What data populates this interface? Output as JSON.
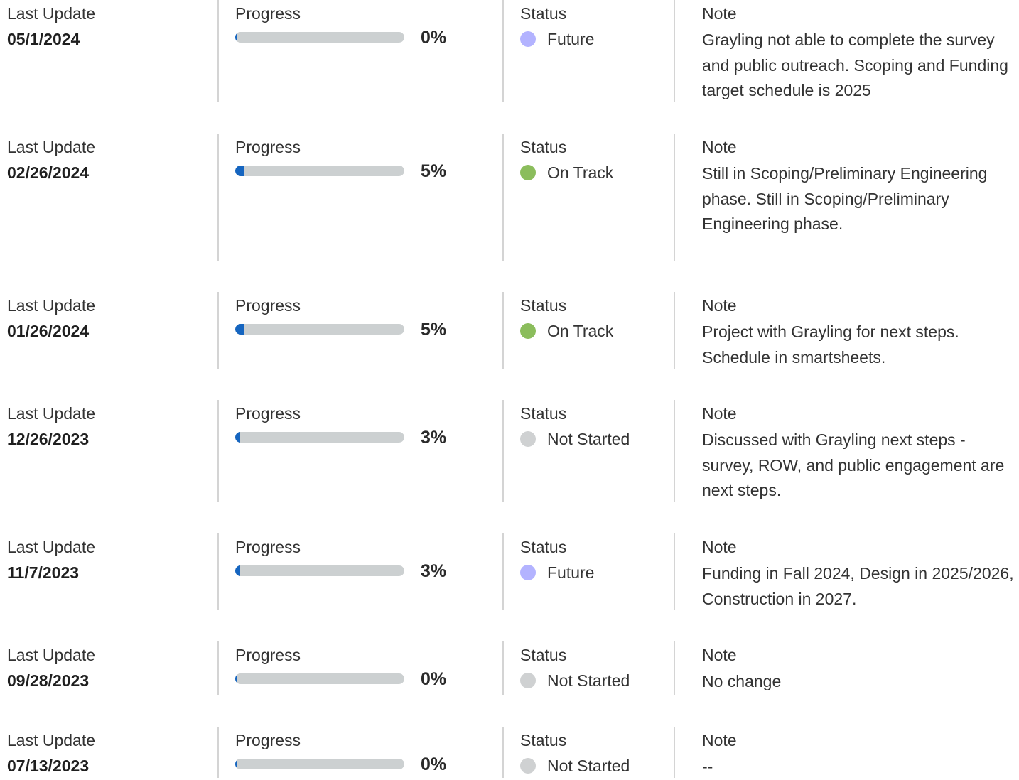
{
  "labels": {
    "last_update": "Last Update",
    "progress": "Progress",
    "status": "Status",
    "note": "Note"
  },
  "colors": {
    "progress_fill": "#1565c0",
    "progress_track": "#ccd0d1",
    "status_future": "#b3b3ff",
    "status_on_track": "#8bbd5c",
    "status_not_started": "#cfd1d2"
  },
  "updates": [
    {
      "date": "05/1/2024",
      "progress_pct": 0,
      "progress_label": "0%",
      "status": "Future",
      "status_color": "#b3b3ff",
      "note": "Grayling not able to complete the survey and public outreach. Scoping and Funding target schedule is 2025"
    },
    {
      "date": "02/26/2024",
      "progress_pct": 5,
      "progress_label": "5%",
      "status": "On Track",
      "status_color": "#8bbd5c",
      "note": "Still in Scoping/Preliminary Engineering phase. Still in Scoping/Preliminary Engineering phase."
    },
    {
      "date": "01/26/2024",
      "progress_pct": 5,
      "progress_label": "5%",
      "status": "On Track",
      "status_color": "#8bbd5c",
      "note": "Project with Grayling for next steps. Schedule in smartsheets."
    },
    {
      "date": "12/26/2023",
      "progress_pct": 3,
      "progress_label": "3%",
      "status": "Not Started",
      "status_color": "#cfd1d2",
      "note": "Discussed with Grayling next steps - survey, ROW, and public engagement are next steps."
    },
    {
      "date": "11/7/2023",
      "progress_pct": 3,
      "progress_label": "3%",
      "status": "Future",
      "status_color": "#b3b3ff",
      "note": "Funding in Fall 2024, Design in 2025/2026, Construction in 2027."
    },
    {
      "date": "09/28/2023",
      "progress_pct": 0,
      "progress_label": "0%",
      "status": "Not Started",
      "status_color": "#cfd1d2",
      "note": "No change"
    },
    {
      "date": "07/13/2023",
      "progress_pct": 0,
      "progress_label": "0%",
      "status": "Not Started",
      "status_color": "#cfd1d2",
      "note": "--"
    }
  ]
}
